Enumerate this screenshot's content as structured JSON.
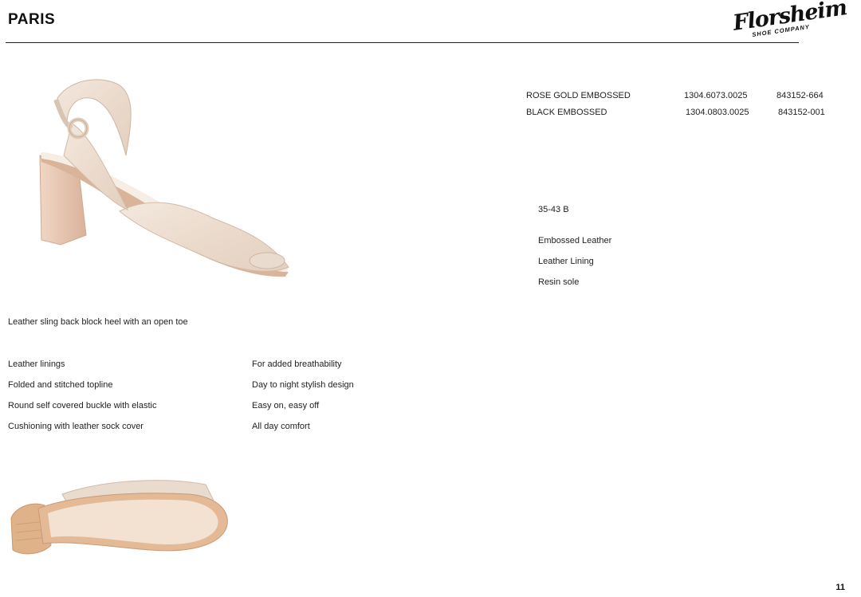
{
  "header": {
    "title": "PARIS",
    "logo_text": "Florsheim",
    "logo_subtext": "SHOE COMPANY"
  },
  "colorways": [
    {
      "name": "ROSE GOLD EMBOSSED",
      "style_code": "1304.6073.0025",
      "upc": "843152-664"
    },
    {
      "name": "BLACK EMBOSSED",
      "style_code": "1304.0803.0025",
      "upc": "843152-001"
    }
  ],
  "specs": {
    "sizes": "35-43 B",
    "upper": "Embossed Leather",
    "lining": "Leather Lining",
    "sole": "Resin sole"
  },
  "description": "Leather sling back block heel with an open toe",
  "features": [
    {
      "feature": "Leather linings",
      "benefit": "For added breathability"
    },
    {
      "feature": "Folded and stitched topline",
      "benefit": "Day to night stylish design"
    },
    {
      "feature": "Round self covered buckle with elastic",
      "benefit": "Easy on, easy off"
    },
    {
      "feature": "Cushioning with leather sock cover",
      "benefit": "All day comfort"
    }
  ],
  "footer": {
    "page_number": "11"
  },
  "colors": {
    "shoe_upper": "#eadbcf",
    "shoe_heel": "#e6c4b1",
    "outsole": "#e0b28a"
  }
}
